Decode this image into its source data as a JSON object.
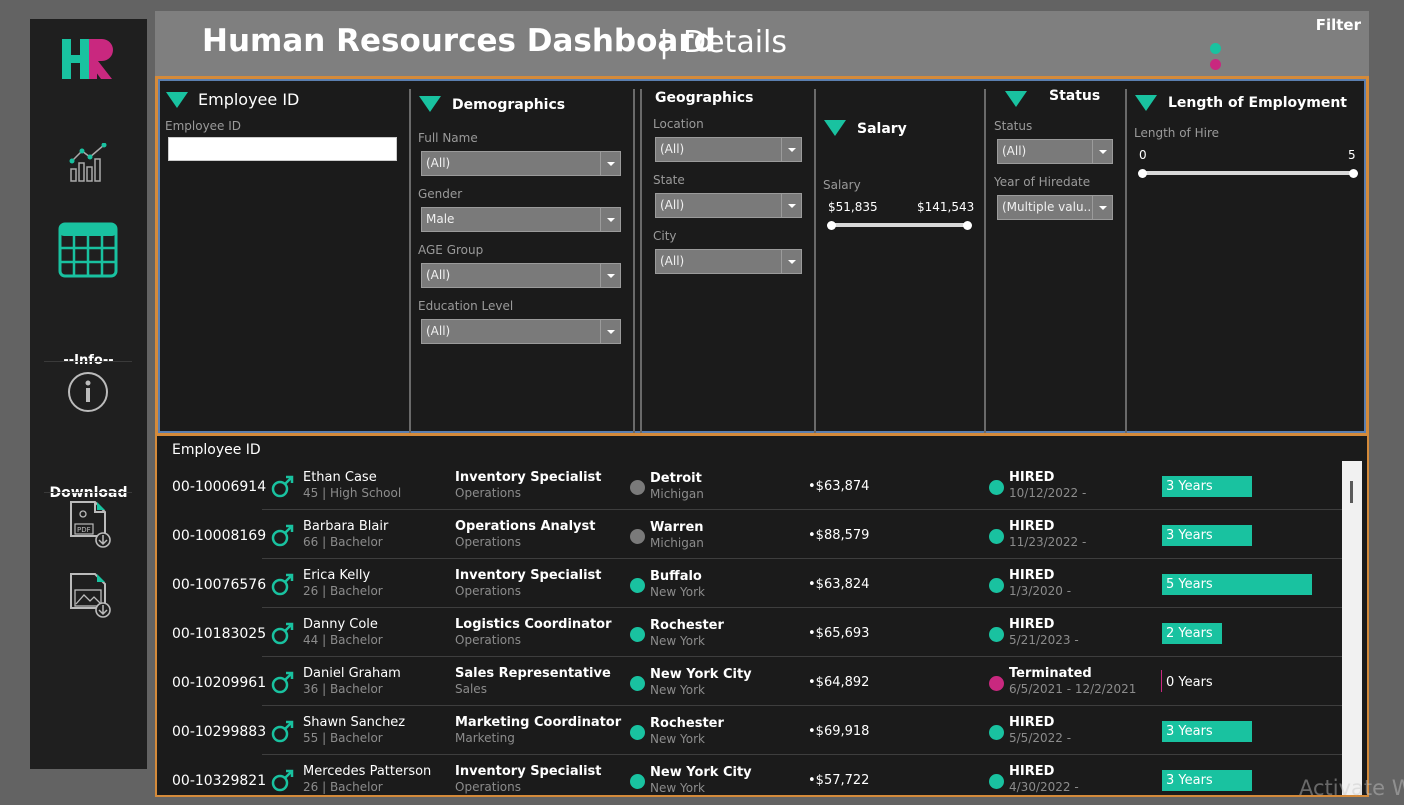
{
  "header": {
    "title": "Human Resources Dashboard",
    "separator": "|",
    "subtitle": "Details",
    "filter_label": "Filter",
    "dot_colors": [
      "#19c2a0",
      "#c9287f"
    ]
  },
  "sidebar": {
    "logo_text": "HR",
    "info_label": "--Info--",
    "download_label": "Download",
    "icons": [
      "analytics-chart-icon",
      "table-grid-icon",
      "info-icon",
      "pdf-download-icon",
      "image-download-icon"
    ]
  },
  "filters": {
    "employee_id": {
      "heading": "Employee ID",
      "field_label": "Employee ID",
      "value": ""
    },
    "demographics": {
      "heading": "Demographics",
      "full_name_label": "Full Name",
      "full_name_value": "(All)",
      "gender_label": "Gender",
      "gender_value": "Male",
      "age_label": "AGE Group",
      "age_value": "(All)",
      "education_label": "Education Level",
      "education_value": "(All)"
    },
    "geographics": {
      "heading": "Geographics",
      "location_label": "Location",
      "location_value": "(All)",
      "state_label": "State",
      "state_value": "(All)",
      "city_label": "City",
      "city_value": "(All)"
    },
    "salary": {
      "heading": "Salary",
      "label": "Salary",
      "min": "$51,835",
      "max": "$141,543",
      "selected_fraction": [
        0,
        1
      ]
    },
    "status": {
      "heading": "Status",
      "status_label": "Status",
      "status_value": "(All)",
      "year_label": "Year of Hiredate",
      "year_value": "(Multiple valu..."
    },
    "length": {
      "heading": "Length of Employment",
      "label": "Length of Hire",
      "min": "0",
      "max": "5",
      "selected_fraction": [
        0,
        1
      ]
    }
  },
  "table": {
    "header": "Employee ID",
    "rows": [
      {
        "id": "00-10006914",
        "name": "Ethan  Case",
        "age_edu": "45 | High School",
        "title": "Inventory Specialist",
        "dept": "Operations",
        "city": "Detroit",
        "state": "Michigan",
        "dot_color": "#7a7a7a",
        "salary": "$63,874",
        "status": "HIRED",
        "dates": "10/12/2022 -",
        "status_color": "#19c2a0",
        "years_label": "3 Years",
        "years": 3
      },
      {
        "id": "00-10008169",
        "name": "Barbara  Blair",
        "age_edu": "66 | Bachelor",
        "title": "Operations Analyst",
        "dept": "Operations",
        "city": "Warren",
        "state": "Michigan",
        "dot_color": "#7a7a7a",
        "salary": "$88,579",
        "status": "HIRED",
        "dates": "11/23/2022 -",
        "status_color": "#19c2a0",
        "years_label": "3 Years",
        "years": 3
      },
      {
        "id": "00-10076576",
        "name": "Erica  Kelly",
        "age_edu": "26 | Bachelor",
        "title": "Inventory Specialist",
        "dept": "Operations",
        "city": "Buffalo",
        "state": "New York",
        "dot_color": "#19c2a0",
        "salary": "$63,824",
        "status": "HIRED",
        "dates": "1/3/2020 -",
        "status_color": "#19c2a0",
        "years_label": "5 Years",
        "years": 5
      },
      {
        "id": "00-10183025",
        "name": "Danny  Cole",
        "age_edu": "44 | Bachelor",
        "title": "Logistics Coordinator",
        "dept": "Operations",
        "city": "Rochester",
        "state": "New York",
        "dot_color": "#19c2a0",
        "salary": "$65,693",
        "status": "HIRED",
        "dates": "5/21/2023 -",
        "status_color": "#19c2a0",
        "years_label": "2 Years",
        "years": 2
      },
      {
        "id": "00-10209961",
        "name": "Daniel  Graham",
        "age_edu": "36 | Bachelor",
        "title": "Sales Representative",
        "dept": "Sales",
        "city": "New York City",
        "state": "New York",
        "dot_color": "#19c2a0",
        "salary": "$64,892",
        "status": "Terminated",
        "dates": "6/5/2021 - 12/2/2021",
        "status_color": "#c9287f",
        "years_label": "0 Years",
        "years": 0
      },
      {
        "id": "00-10299883",
        "name": "Shawn  Sanchez",
        "age_edu": "55 | Bachelor",
        "title": "Marketing Coordinator",
        "dept": "Marketing",
        "city": "Rochester",
        "state": "New York",
        "dot_color": "#19c2a0",
        "salary": "$69,918",
        "status": "HIRED",
        "dates": "5/5/2022 -",
        "status_color": "#19c2a0",
        "years_label": "3 Years",
        "years": 3
      },
      {
        "id": "00-10329821",
        "name": "Mercedes  Patterson",
        "age_edu": "26 | Bachelor",
        "title": "Inventory Specialist",
        "dept": "Operations",
        "city": "New York City",
        "state": "New York",
        "dot_color": "#19c2a0",
        "salary": "$57,722",
        "status": "HIRED",
        "dates": "4/30/2022 -",
        "status_color": "#19c2a0",
        "years_label": "3 Years",
        "years": 3
      }
    ],
    "max_years": 5
  },
  "watermark": "Activate W",
  "colors": {
    "accent_teal": "#19c2a0",
    "accent_magenta": "#c9287f",
    "panel_border_orange": "#d48a3a",
    "panel_border_blue": "#5b7fb0"
  }
}
